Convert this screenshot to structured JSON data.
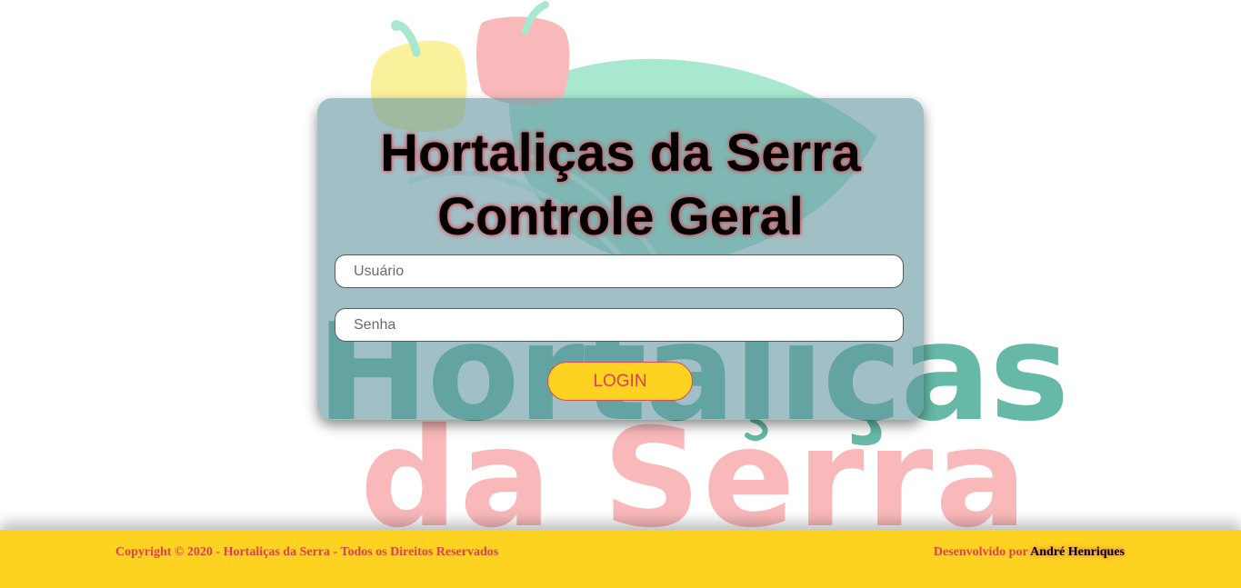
{
  "login": {
    "title_line1": "Hortaliças da Serra",
    "title_line2": "Controle Geral",
    "username_placeholder": "Usuário",
    "password_placeholder": "Senha",
    "login_label": "LOGIN"
  },
  "footer": {
    "copyright": "Copyright © 2020 - Hortaliças da Serra - Todos os Direitos Reservados",
    "developed_by_prefix": "Desenvolvido por",
    "developer_name": "André Henriques"
  },
  "logo": {
    "word1": "Hortaliças",
    "word2": "da Serra"
  },
  "colors": {
    "accent_yellow": "#fdd221",
    "accent_red": "#e0404f",
    "logo_green": "#65b9a6",
    "logo_pink": "#f9b9ba",
    "card_bg": "#9fbfc4"
  }
}
